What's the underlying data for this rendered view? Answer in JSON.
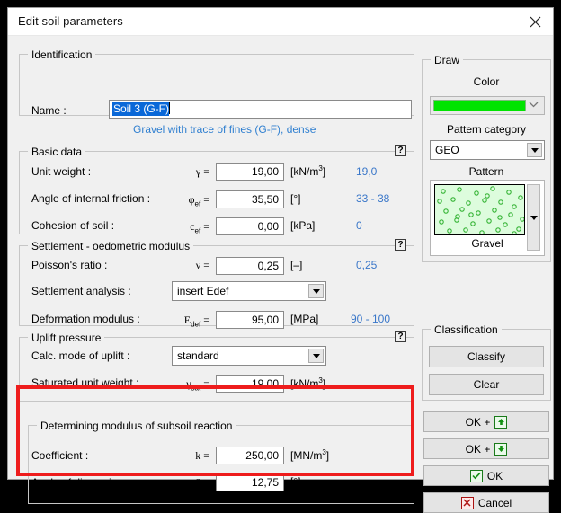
{
  "window": {
    "title": "Edit soil parameters",
    "close_icon": "close-icon"
  },
  "identification": {
    "legend": "Identification",
    "name_label": "Name :",
    "name_value": "Soil 3 (G-F)",
    "description": "Gravel with trace of fines (G-F), dense"
  },
  "basic_data": {
    "legend": "Basic data",
    "help": "?",
    "rows": [
      {
        "label": "Unit weight :",
        "symbol": "γ =",
        "value": "19,00",
        "unit_main": "[kN/m",
        "unit_sup": "3",
        "unit_tail": "]",
        "hint": "19,0"
      },
      {
        "label": "Angle of internal friction :",
        "symbol": "φef =",
        "value": "35,50",
        "unit_main": "[°]",
        "unit_sup": "",
        "unit_tail": "",
        "hint": "33 - 38"
      },
      {
        "label": "Cohesion of soil :",
        "symbol": "cef =",
        "value": "0,00",
        "unit_main": "[kPa]",
        "unit_sup": "",
        "unit_tail": "",
        "hint": "0"
      }
    ]
  },
  "settlement": {
    "legend": "Settlement - oedometric modulus",
    "help": "?",
    "poisson_label": "Poisson's ratio :",
    "poisson_symbol": "ν =",
    "poisson_value": "0,25",
    "poisson_unit": "[–]",
    "poisson_hint": "0,25",
    "analysis_label": "Settlement analysis :",
    "analysis_value": "insert Edef",
    "modulus_label": "Deformation modulus :",
    "modulus_symbol": "Edef =",
    "modulus_value": "95,00",
    "modulus_unit": "[MPa]",
    "modulus_hint": "90 - 100"
  },
  "uplift": {
    "legend": "Uplift pressure",
    "help": "?",
    "mode_label": "Calc. mode of uplift :",
    "mode_value": "standard",
    "sat_label": "Saturated unit weight :",
    "sat_symbol": "γsat =",
    "sat_value": "19,00",
    "sat_unit_main": "[kN/m",
    "sat_unit_sup": "3",
    "sat_unit_tail": "]"
  },
  "subsoil": {
    "legend": "Determining modulus of subsoil reaction",
    "coefficient_label": "Coefficient :",
    "coefficient_symbol": "k =",
    "coefficient_value": "250,00",
    "coefficient_unit_main": "[MN/m",
    "coefficient_unit_sup": "3",
    "coefficient_unit_tail": "]",
    "angle_label": "Angle of dispersion :",
    "angle_symbol": "β =",
    "angle_value": "12,75",
    "angle_unit": "[°]",
    "highlight_color": "#ee1c1c"
  },
  "draw": {
    "legend": "Draw",
    "color_label": "Color",
    "color_value": "#00e400",
    "pattern_category_label": "Pattern category",
    "pattern_category_value": "GEO",
    "pattern_label": "Pattern",
    "pattern_name": "Gravel",
    "pattern_bg": "#ddfcdd",
    "pattern_dot": "#35b435"
  },
  "classification": {
    "legend": "Classification",
    "classify_label": "Classify",
    "clear_label": "Clear"
  },
  "actions": {
    "ok_up_label": "OK +",
    "ok_down_label": "OK +",
    "ok_label": "OK",
    "cancel_label": "Cancel"
  }
}
